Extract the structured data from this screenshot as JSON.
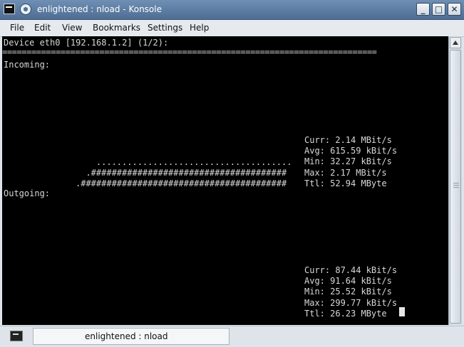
{
  "window": {
    "title": "enlightened : nload - Konsole"
  },
  "menu": [
    "File",
    "Edit",
    "View",
    "Bookmarks",
    "Settings",
    "Help"
  ],
  "terminal": {
    "device_line": "Device eth0 [192.168.1.2] (1/2):",
    "separator": "=============================================================================",
    "incoming_label": "Incoming:",
    "incoming_graph": "    ......................................\n  .######################################\n.########################################",
    "incoming_stats": "Curr: 2.14 MBit/s\nAvg: 615.59 kBit/s\nMin: 32.27 kBit/s\nMax: 2.17 MBit/s\nTtl: 52.94 MByte",
    "outgoing_label": "Outgoing:",
    "outgoing_stats": "Curr: 87.44 kBit/s\nAvg: 91.64 kBit/s\nMin: 25.52 kBit/s\nMax: 299.77 kBit/s\nTtl: 26.23 MByte"
  },
  "statusbar": {
    "session_tab": "enlightened : nload"
  }
}
